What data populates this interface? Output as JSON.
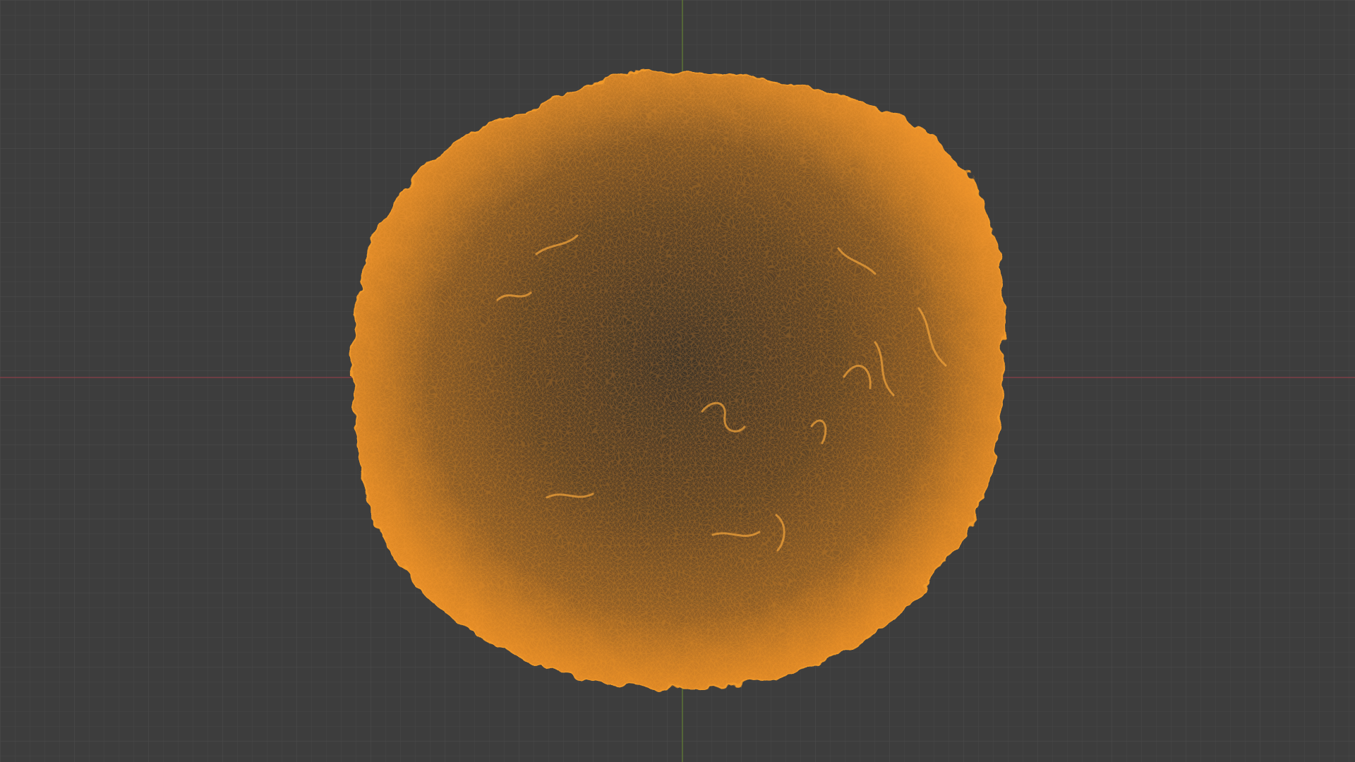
{
  "viewport": {
    "mode": "wireframe",
    "grid_visible": true,
    "colors": {
      "background": "#3d3d3d",
      "grid_minor": "#464646",
      "grid_major": "#4d4d4d",
      "x_axis": "#8a4048",
      "y_axis": "#5f7a34",
      "mesh_wire": "#f0992a",
      "mesh_fill": "#6a4a22",
      "mesh_dark": "#3f3428"
    }
  },
  "object": {
    "selected": true,
    "icon": "mesh-object-icon"
  }
}
